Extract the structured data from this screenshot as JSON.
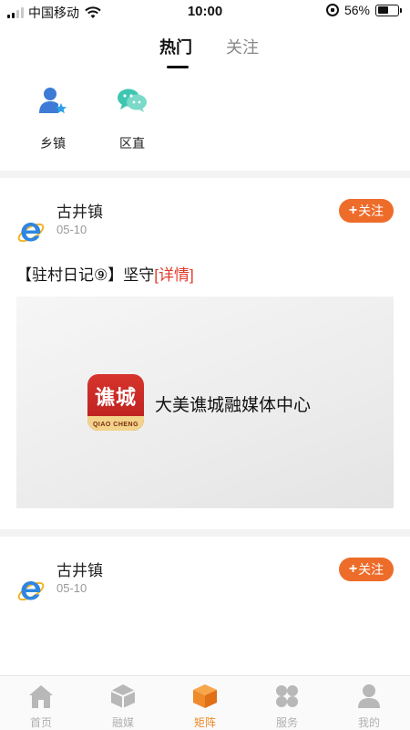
{
  "status_bar": {
    "carrier": "中国移动",
    "time": "10:00",
    "battery": "56%",
    "battery_level": 0.56
  },
  "top_tabs": {
    "hot": "热门",
    "follow": "关注"
  },
  "categories": [
    {
      "label": "乡镇",
      "icon": "user-star-icon"
    },
    {
      "label": "区直",
      "icon": "chat-bubbles-icon"
    }
  ],
  "posts": [
    {
      "author": "古井镇",
      "date": "05-10",
      "follow_label": "关注",
      "title": "【驻村日记⑨】坚守",
      "link_label": "[详情]",
      "image": {
        "logo_text": "谯城",
        "logo_en": "QIAO CHENG",
        "app_name": "大美谯城融媒体中心"
      }
    },
    {
      "author": "古井镇",
      "date": "05-10",
      "follow_label": "关注"
    }
  ],
  "bottom_nav": [
    {
      "label": "首页",
      "icon": "home-icon",
      "active": false
    },
    {
      "label": "融媒",
      "icon": "cube-icon",
      "active": false
    },
    {
      "label": "矩阵",
      "icon": "box-icon",
      "active": true
    },
    {
      "label": "服务",
      "icon": "grid-icon",
      "active": false
    },
    {
      "label": "我的",
      "icon": "person-icon",
      "active": false
    }
  ],
  "colors": {
    "accent": "#ee6c2a",
    "link": "#e23a2a",
    "nav_active": "#ee8a2a",
    "nav_inactive": "#b0b0b0"
  }
}
